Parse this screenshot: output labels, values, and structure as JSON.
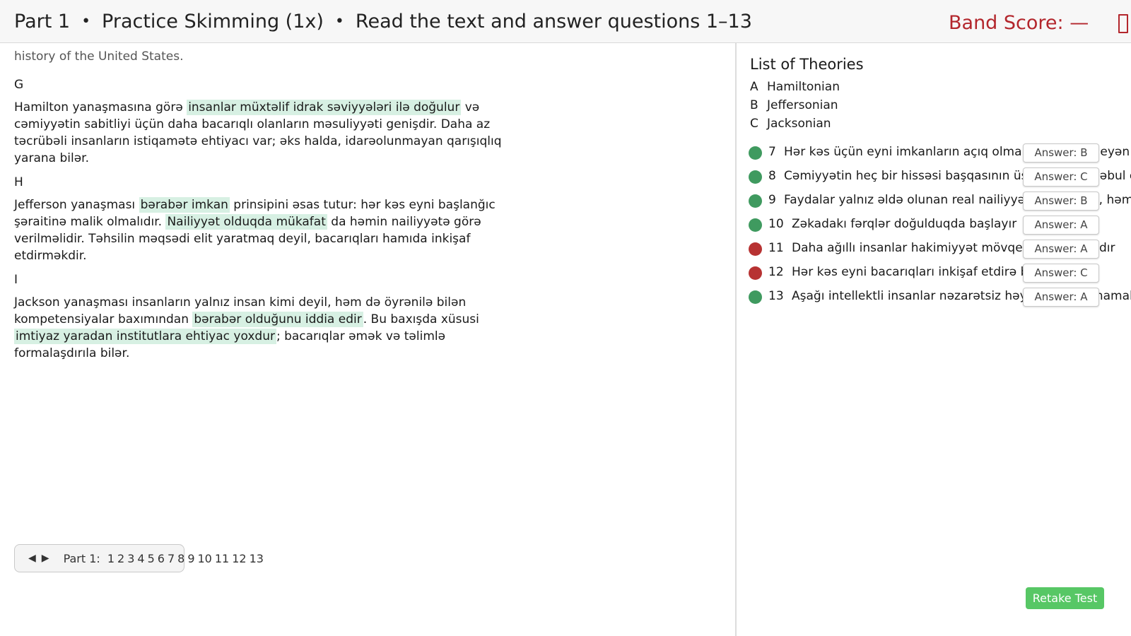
{
  "header": {
    "part": "Part 1",
    "separator": "•",
    "mode": "Practice Skimming (1x)",
    "instruction": "Read the text and answer questions 1–13",
    "band_score": "Band Score: —"
  },
  "passage": {
    "prev_tail": "history of the United States.",
    "sections": [
      {
        "letter": "G",
        "segments": [
          {
            "t": "Hamilton yanaşmasına görə ",
            "hl": false
          },
          {
            "t": "insanlar müxtəlif idrak səviyyələri ilə doğulur",
            "hl": true
          },
          {
            "t": " və cəmiyyətin sabitliyi üçün daha bacarıqlı olanların məsuliyyəti genişdir. Daha az təcrübəli insanların istiqamətə ehtiyacı var; əks halda, idarəolunmayan qarışıqlıq yarana bilər.",
            "hl": false
          }
        ]
      },
      {
        "letter": "H",
        "segments": [
          {
            "t": "Jefferson yanaşması ",
            "hl": false
          },
          {
            "t": "bərabər imkan",
            "hl": true
          },
          {
            "t": " prinsipini əsas tutur: hər kəs eyni başlanğıc şəraitinə malik olmalıdır. ",
            "hl": false
          },
          {
            "t": "Nailiyyət olduqda mükafat",
            "hl": true
          },
          {
            "t": " da həmin nailiyyətə görə verilməlidir. Təhsilin məqsədi elit yaratmaq deyil, bacarıqları hamıda inkişaf etdirməkdir.",
            "hl": false
          }
        ]
      },
      {
        "letter": "I",
        "segments": [
          {
            "t": "Jackson yanaşması insanların yalnız insan kimi deyil, həm də öyrənilə bilən kompetensiyalar baxımından ",
            "hl": false
          },
          {
            "t": "bərabər olduğunu iddia edir",
            "hl": true
          },
          {
            "t": ". Bu baxışda xüsusi ",
            "hl": false
          },
          {
            "t": "imtiyaz yaradan institutlara ehtiyac yoxdur",
            "hl": true
          },
          {
            "t": "; bacarıqlar əmək və təlimlə formalaşdırıla bilər.",
            "hl": false
          }
        ]
      }
    ]
  },
  "pager": {
    "prev_icon": "◀",
    "next_icon": "▶",
    "label": "Part 1:",
    "numbers": [
      "1",
      "2",
      "3",
      "4",
      "5",
      "6",
      "7",
      "8",
      "9",
      "10",
      "11",
      "12",
      "13"
    ]
  },
  "theories": {
    "title": "List of Theories",
    "items": [
      {
        "letter": "A",
        "name": "Hamiltonian"
      },
      {
        "letter": "B",
        "name": "Jeffersonian"
      },
      {
        "letter": "C",
        "name": "Jacksonian"
      }
    ]
  },
  "questions": [
    {
      "num": "7",
      "text": "Hər kəs üçün eyni imkanların açıq olmalı olduğunu deyən yanaşma",
      "answer": "Answer: B",
      "status": "correct"
    },
    {
      "num": "8",
      "text": "Cəmiyyətin heç bir hissəsi başqasının üstünlüyünü qəbul etməyə məcbur deyil",
      "answer": "Answer: C",
      "status": "correct"
    },
    {
      "num": "9",
      "text": "Faydalar yalnız əldə olunan real nailiyyətlərə əsasən, həm də daha v",
      "answer": "Answer: B",
      "status": "correct"
    },
    {
      "num": "10",
      "text": "Zəkadakı fərqlər doğulduqda başlayır",
      "answer": "Answer: A",
      "status": "correct"
    },
    {
      "num": "11",
      "text": "Daha ağıllı insanlar hakimiyyət mövqelərini tutmalıdır",
      "answer": "Answer: A",
      "status": "wrong"
    },
    {
      "num": "12",
      "text": "Hər kəs eyni bacarıqları inkişaf etdirə bilər",
      "answer": "Answer: C",
      "status": "wrong"
    },
    {
      "num": "13",
      "text": "Aşağı intellektli insanlar nəzarətsiz həyata buraxılmamalıdırlar",
      "answer": "Answer: A",
      "status": "correct"
    }
  ],
  "status_colors": {
    "correct": "#3f9a5f",
    "wrong": "#b73232"
  },
  "retake_label": "Retake Test"
}
